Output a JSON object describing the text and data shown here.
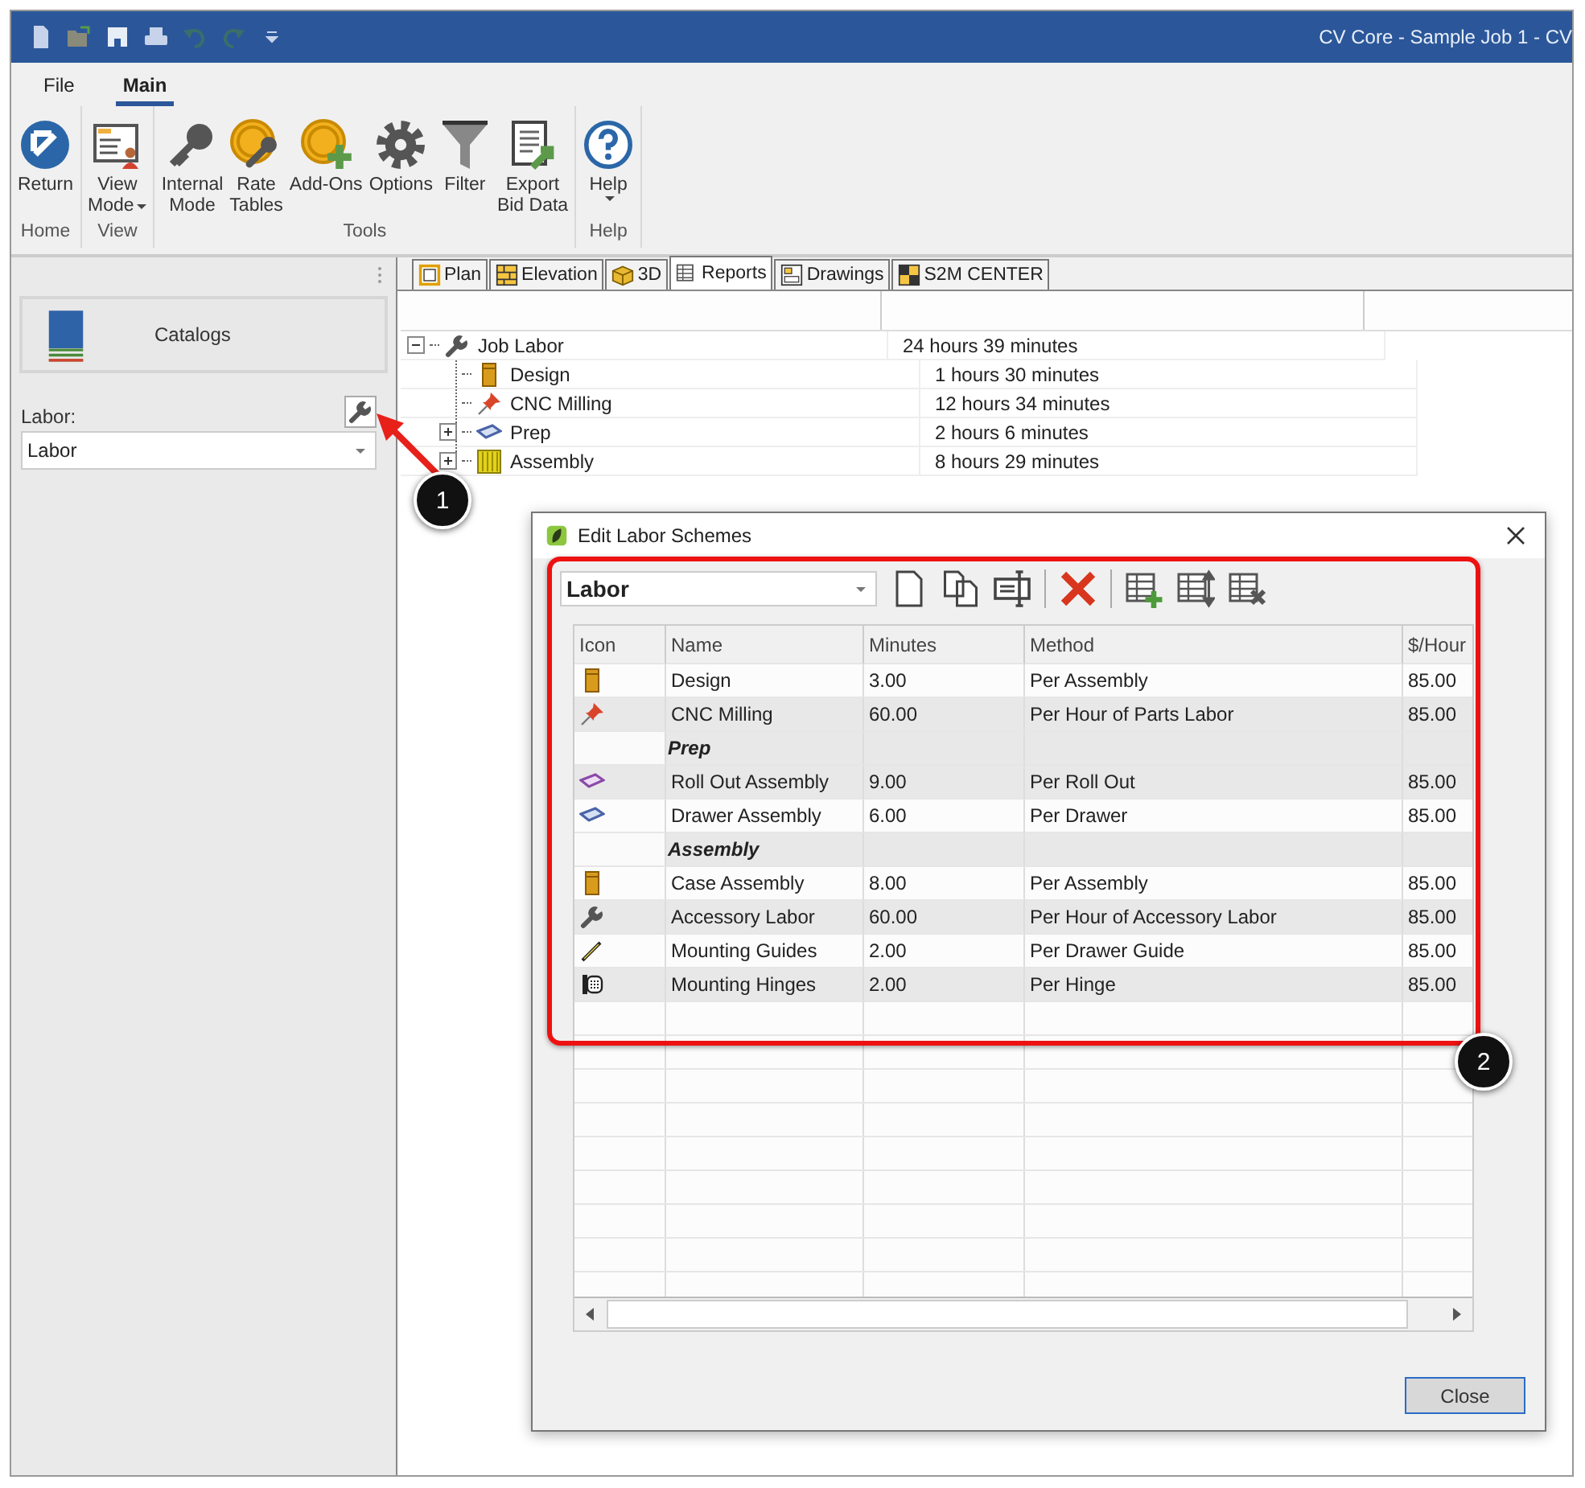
{
  "window": {
    "title": "CV Core - Sample Job 1 - CV"
  },
  "ribbon": {
    "tabs": [
      {
        "label": "File",
        "selected": false
      },
      {
        "label": "Main",
        "selected": true
      }
    ],
    "groups": [
      {
        "label": "Home",
        "buttons": [
          {
            "kind": "return",
            "lines": [
              "Return"
            ],
            "dropdown": false
          }
        ]
      },
      {
        "label": "View",
        "buttons": [
          {
            "kind": "view-mode",
            "lines": [
              "View",
              "Mode"
            ],
            "dropdown": true
          }
        ]
      },
      {
        "label": "Tools",
        "buttons": [
          {
            "kind": "key",
            "lines": [
              "Internal",
              "Mode"
            ],
            "dropdown": false
          },
          {
            "kind": "rate",
            "lines": [
              "Rate",
              "Tables"
            ],
            "dropdown": false
          },
          {
            "kind": "addons",
            "lines": [
              "Add-Ons"
            ],
            "dropdown": false
          },
          {
            "kind": "gear",
            "lines": [
              "Options"
            ],
            "dropdown": false
          },
          {
            "kind": "funnel",
            "lines": [
              "Filter"
            ],
            "dropdown": false
          },
          {
            "kind": "export",
            "lines": [
              "Export",
              "Bid Data"
            ],
            "dropdown": false
          }
        ]
      },
      {
        "label": "Help",
        "buttons": [
          {
            "kind": "help",
            "lines": [
              "Help"
            ],
            "dropdown": true
          }
        ]
      }
    ]
  },
  "sidebar": {
    "catalogs": "Catalogs",
    "labor_label": "Labor:",
    "labor_select": "Labor"
  },
  "view_tabs": [
    {
      "kind": "plan",
      "label": "Plan",
      "selected": false
    },
    {
      "kind": "elevation",
      "label": "Elevation",
      "selected": false
    },
    {
      "kind": "cube",
      "label": "3D",
      "selected": false
    },
    {
      "kind": "reports",
      "label": "Reports",
      "selected": true
    },
    {
      "kind": "drawings",
      "label": "Drawings",
      "selected": false
    },
    {
      "kind": "s2m",
      "label": "S2M CENTER",
      "selected": false
    }
  ],
  "report": {
    "rows": [
      {
        "kind": "wrench",
        "name": "Job Labor",
        "time": "24 hours 39 minutes",
        "expanded": true,
        "children": [
          {
            "kind": "cabinet",
            "name": "Design",
            "time": "1 hours 30 minutes"
          },
          {
            "kind": "pin",
            "name": "CNC Milling",
            "time": "12 hours 34 minutes"
          },
          {
            "kind": "drawer",
            "name": "Prep",
            "time": "2 hours 6 minutes",
            "expanded": false
          },
          {
            "kind": "assembly",
            "name": "Assembly",
            "time": "8 hours 29 minutes",
            "expanded": false
          }
        ]
      }
    ]
  },
  "dialog": {
    "title": "Edit Labor Schemes",
    "scheme": "Labor",
    "columns": [
      "Icon",
      "Name",
      "Minutes",
      "Method",
      "$/Hour"
    ],
    "rows": [
      {
        "kind": "cabinet",
        "name": "Design",
        "minutes": "3.00",
        "method": "Per Assembly",
        "rate": "85.00"
      },
      {
        "kind": "pin",
        "name": "CNC Milling",
        "minutes": "60.00",
        "method": "Per Hour of Parts Labor",
        "rate": "85.00"
      },
      {
        "kind": "group",
        "name": "Prep"
      },
      {
        "kind": "rollout",
        "name": "Roll Out Assembly",
        "minutes": "9.00",
        "method": "Per Roll Out",
        "rate": "85.00"
      },
      {
        "kind": "drawer",
        "name": "Drawer Assembly",
        "minutes": "6.00",
        "method": "Per Drawer",
        "rate": "85.00"
      },
      {
        "kind": "group",
        "name": "Assembly"
      },
      {
        "kind": "cabinet",
        "name": "Case Assembly",
        "minutes": "8.00",
        "method": "Per Assembly",
        "rate": "85.00"
      },
      {
        "kind": "wrench",
        "name": "Accessory Labor",
        "minutes": "60.00",
        "method": "Per Hour of Accessory Labor",
        "rate": "85.00"
      },
      {
        "kind": "guide",
        "name": "Mounting Guides",
        "minutes": "2.00",
        "method": "Per Drawer Guide",
        "rate": "85.00"
      },
      {
        "kind": "hinge",
        "name": "Mounting Hinges",
        "minutes": "2.00",
        "method": "Per Hinge",
        "rate": "85.00"
      }
    ],
    "close": "Close"
  },
  "annotations": [
    {
      "label": "1"
    },
    {
      "label": "2"
    }
  ]
}
